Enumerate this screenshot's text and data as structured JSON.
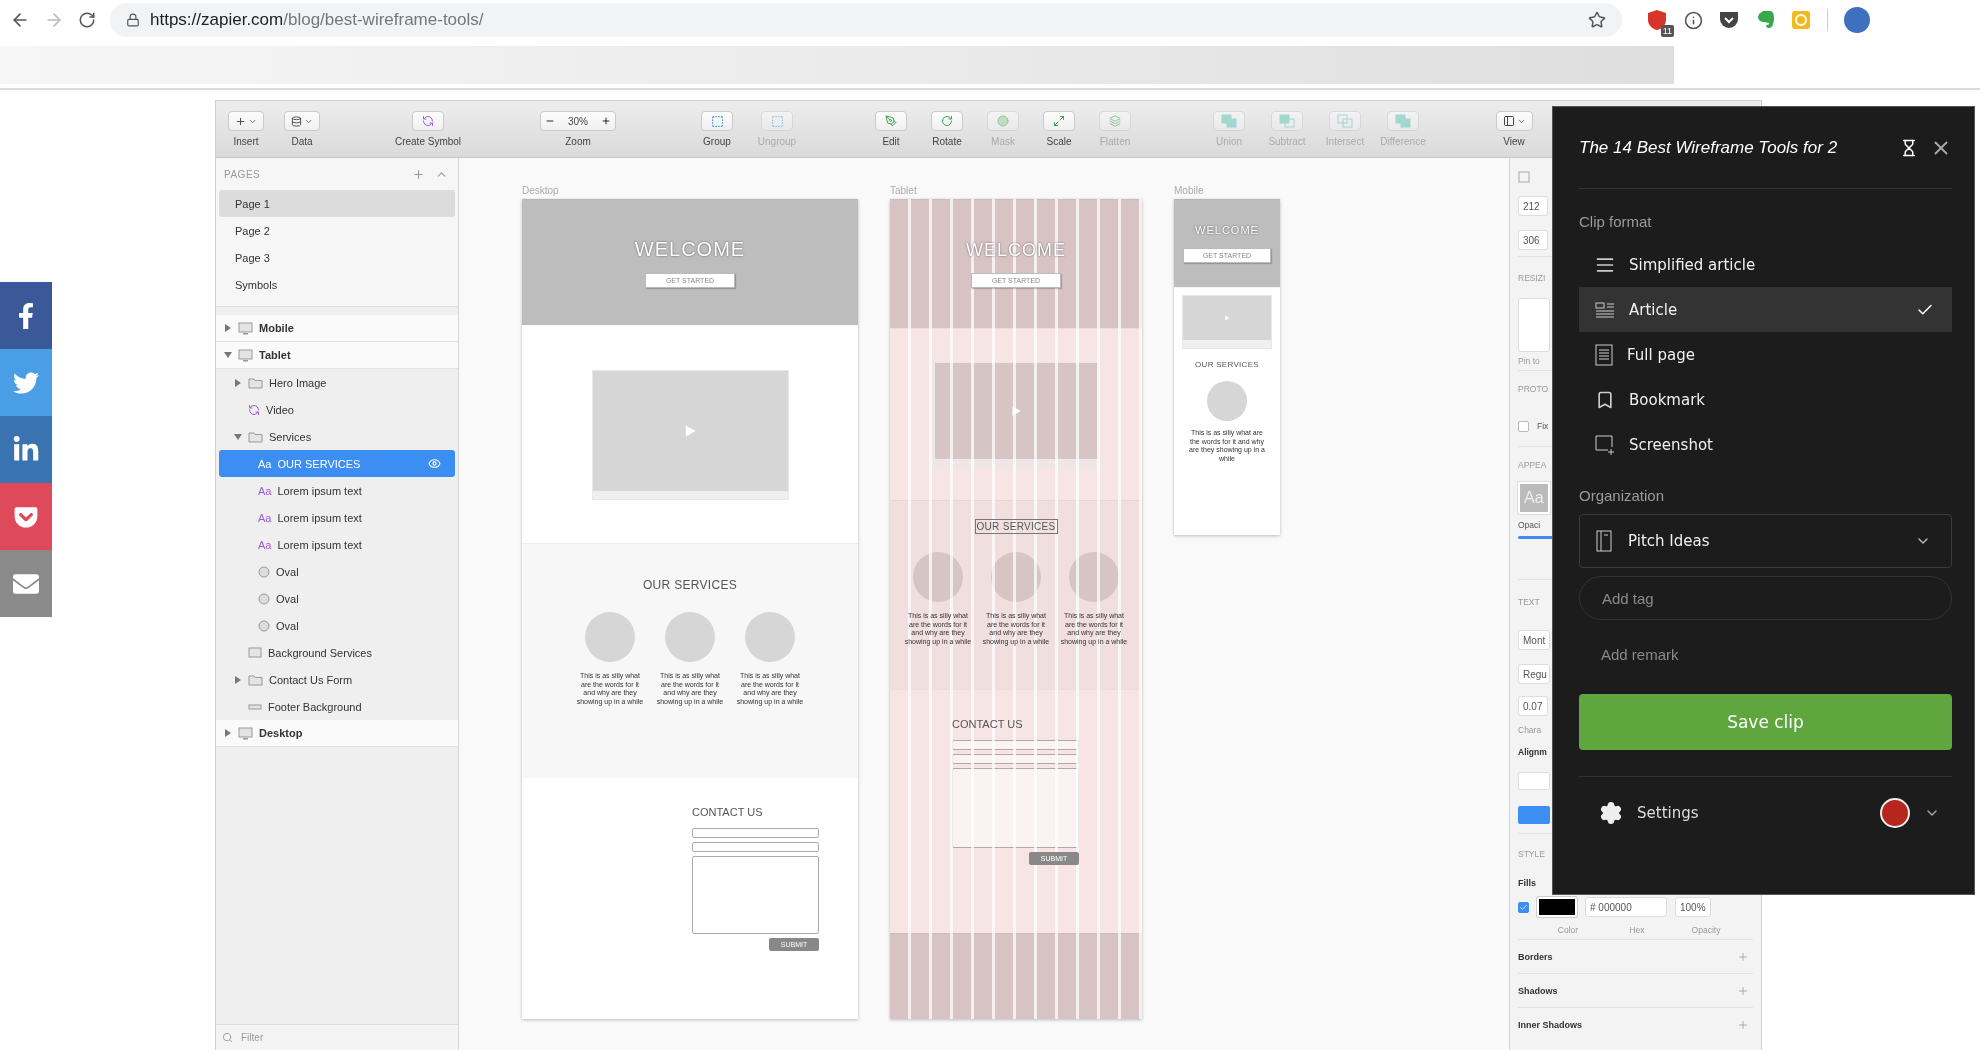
{
  "browser": {
    "url_host": "https://zapier.com",
    "url_path": "/blog/best-wireframe-tools/",
    "extension_badge": "11"
  },
  "share_buttons": [
    {
      "kind": "facebook",
      "color": "#3b5998"
    },
    {
      "kind": "twitter",
      "color": "#4a9ee6"
    },
    {
      "kind": "linkedin",
      "color": "#3a74b0"
    },
    {
      "kind": "pocket",
      "color": "#df4a5b"
    },
    {
      "kind": "email",
      "color": "#8a8a8a"
    }
  ],
  "toolbar": [
    {
      "tools": [
        {
          "label": "Insert",
          "kind": "insert",
          "disabled": false
        },
        {
          "label": "Data",
          "kind": "data",
          "disabled": false
        }
      ]
    },
    {
      "tools": [
        {
          "label": "Create Symbol",
          "kind": "symbol",
          "disabled": false
        }
      ]
    },
    {
      "tools": [
        {
          "label": "Zoom",
          "kind": "zoom",
          "value": "30%",
          "disabled": false
        }
      ]
    },
    {
      "tools": [
        {
          "label": "Group",
          "kind": "group",
          "disabled": false
        },
        {
          "label": "Ungroup",
          "kind": "ungroup",
          "disabled": true
        }
      ]
    },
    {
      "tools": [
        {
          "label": "Edit",
          "kind": "edit",
          "disabled": false
        },
        {
          "label": "Rotate",
          "kind": "rotate",
          "disabled": false
        },
        {
          "label": "Mask",
          "kind": "mask",
          "disabled": true
        },
        {
          "label": "Scale",
          "kind": "scale",
          "disabled": false
        },
        {
          "label": "Flatten",
          "kind": "flatten",
          "disabled": true
        }
      ]
    },
    {
      "tools": [
        {
          "label": "Union",
          "kind": "union",
          "disabled": true
        },
        {
          "label": "Subtract",
          "kind": "subtract",
          "disabled": true
        },
        {
          "label": "Intersect",
          "kind": "intersect",
          "disabled": true
        },
        {
          "label": "Difference",
          "kind": "difference",
          "disabled": true
        }
      ]
    },
    {
      "tools": [
        {
          "label": "View",
          "kind": "view",
          "disabled": false
        }
      ]
    }
  ],
  "pages": {
    "title": "PAGES",
    "items": [
      {
        "label": "Page 1",
        "selected": true
      },
      {
        "label": "Page 2",
        "selected": false
      },
      {
        "label": "Page 3",
        "selected": false
      },
      {
        "label": "Symbols",
        "selected": false
      }
    ]
  },
  "layers": [
    {
      "label": "Mobile",
      "kind": "artboard",
      "expanded": false,
      "selected": false
    },
    {
      "label": "Tablet",
      "kind": "artboard",
      "expanded": true,
      "selected": false,
      "children": [
        {
          "label": "Hero Image",
          "kind": "group",
          "expanded": false,
          "selected": false
        },
        {
          "label": "Video",
          "kind": "symbol",
          "selected": false
        },
        {
          "label": "Services",
          "kind": "group",
          "expanded": true,
          "selected": false,
          "children": [
            {
              "label": "OUR SERVICES",
              "kind": "text",
              "icon_text": "Aa",
              "selected": true
            },
            {
              "label": "Lorem ipsum text",
              "kind": "text",
              "icon_text": "Aa",
              "selected": false
            },
            {
              "label": "Lorem ipsum text",
              "kind": "text",
              "icon_text": "Aa",
              "selected": false
            },
            {
              "label": "Lorem ipsum text",
              "kind": "text",
              "icon_text": "Aa",
              "selected": false
            },
            {
              "label": "Oval",
              "kind": "oval",
              "selected": false
            },
            {
              "label": "Oval",
              "kind": "oval",
              "selected": false
            },
            {
              "label": "Oval",
              "kind": "oval",
              "selected": false
            }
          ]
        },
        {
          "label": "Background Services",
          "kind": "rect",
          "selected": false
        },
        {
          "label": "Contact Us Form",
          "kind": "group",
          "expanded": false,
          "selected": false
        },
        {
          "label": "Footer Background",
          "kind": "line",
          "selected": false
        }
      ]
    },
    {
      "label": "Desktop",
      "kind": "artboard",
      "expanded": false,
      "selected": false
    }
  ],
  "filter": {
    "placeholder": "Filter"
  },
  "artboards": [
    {
      "label": "Desktop",
      "kind": "desktop",
      "welcome": "WELCOME",
      "cta": "GET STARTED",
      "services_title": "OUR SERVICES",
      "service_texts": [
        "This is as silly what are the words for it and why are they showing up in a while",
        "This is as silly what are the words for it and why are they showing up in a while",
        "This is as silly what are the words for it and why are they showing up in a while"
      ],
      "contact_title": "CONTACT US",
      "submit": "SUBMIT"
    },
    {
      "label": "Tablet",
      "kind": "tablet",
      "welcome": "WELCOME",
      "cta": "GET STARTED",
      "services_title": "OUR SERVICES",
      "service_texts": [
        "This is as silly what are the words for it and why are they showing up in a while",
        "This is as silly what are the words for it and why are they showing up in a while",
        "This is as silly what are the words for it and why are they showing up in a while"
      ],
      "contact_title": "CONTACT US",
      "submit": "SUBMIT"
    },
    {
      "label": "Mobile",
      "kind": "mobile",
      "welcome": "WELCOME",
      "cta": "GET STARTED",
      "services_title": "OUR SERVICES",
      "service_texts": [
        "This is as silly what are the words for it and why are they showing up in a while"
      ]
    }
  ],
  "inspector": {
    "size_fields": [
      "212",
      "306"
    ],
    "resizing_label": "RESIZI",
    "pin_label": "Pin to",
    "prototyping_label": "PROTO",
    "fix_label": "Fix",
    "fix_checked": false,
    "appearance_label": "APPEA",
    "style_preview": "Aa",
    "opacity_label": "Opaci",
    "text_label": "TEXT",
    "font_field": "Mont",
    "weight_field": "Regu",
    "spacing_field": "0.07",
    "character_label": "Chara",
    "alignment_label": "Alignm",
    "style_label": "STYLE",
    "fills_label": "Fills",
    "fill_checked": true,
    "fill_hex": "# 000000",
    "fill_opacity": "100%",
    "fill_captions": [
      "Color",
      "Hex",
      "Opacity"
    ],
    "sections": [
      "Borders",
      "Shadows",
      "Inner Shadows"
    ]
  },
  "clipper": {
    "title": "The 14 Best Wireframe Tools for 2",
    "format_label": "Clip format",
    "formats": [
      {
        "label": "Simplified article",
        "kind": "simplified",
        "selected": false
      },
      {
        "label": "Article",
        "kind": "article",
        "selected": true
      },
      {
        "label": "Full page",
        "kind": "fullpage",
        "selected": false
      },
      {
        "label": "Bookmark",
        "kind": "bookmark",
        "selected": false
      },
      {
        "label": "Screenshot",
        "kind": "screenshot",
        "selected": false
      }
    ],
    "organization_label": "Organization",
    "notebook": "Pitch Ideas",
    "tag": {
      "placeholder": "Add tag"
    },
    "remark": {
      "placeholder": "Add remark"
    },
    "save": "Save clip",
    "settings": "Settings"
  }
}
